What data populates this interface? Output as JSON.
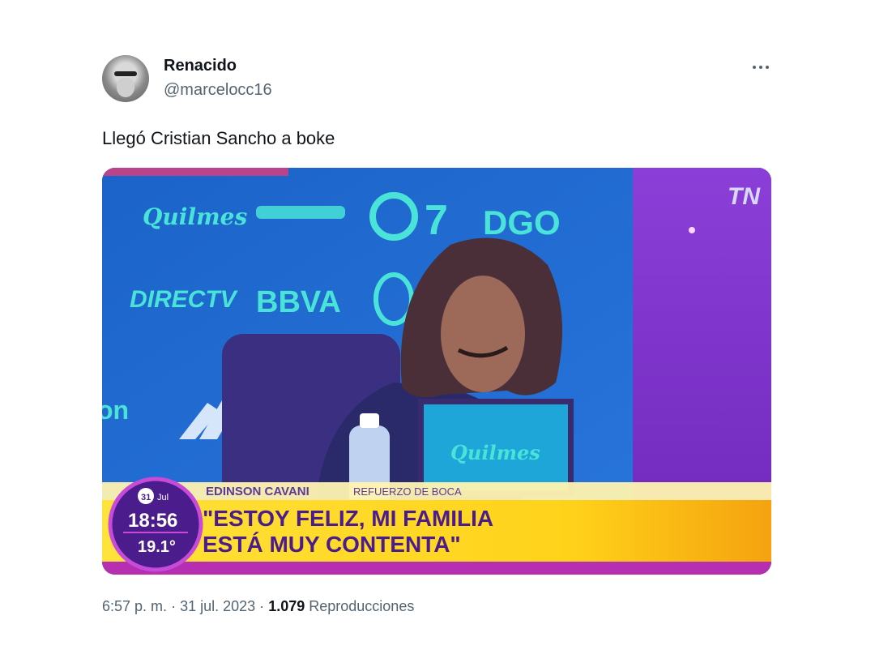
{
  "tweet": {
    "author_name": "Renacido",
    "author_handle": "@marcelocc16",
    "text": "Llegó Cristian Sancho a boke",
    "time": "6:57 p. m.",
    "separator": "·",
    "date": "31 jul. 2023",
    "views_count": "1.079",
    "views_label": "Reproducciones"
  },
  "media": {
    "channel_logo": "TN",
    "sponsors": [
      "Quilmes",
      "DIRECTV",
      "BBVA",
      "DGO"
    ],
    "monitor_logo": "Quilmes",
    "lower_third": {
      "name": "EDINSON CAVANI",
      "role": "REFUERZO DE BOCA",
      "headline_line1": "\"ESTOY FELIZ, MI FAMILIA",
      "headline_line2": "ESTÁ MUY CONTENTA\""
    },
    "clock": {
      "day": "31",
      "month": "Jul",
      "time": "18:56",
      "temperature": "19.1°"
    }
  },
  "icons": {
    "more": "more-horizontal-icon",
    "avatar": "avatar"
  }
}
